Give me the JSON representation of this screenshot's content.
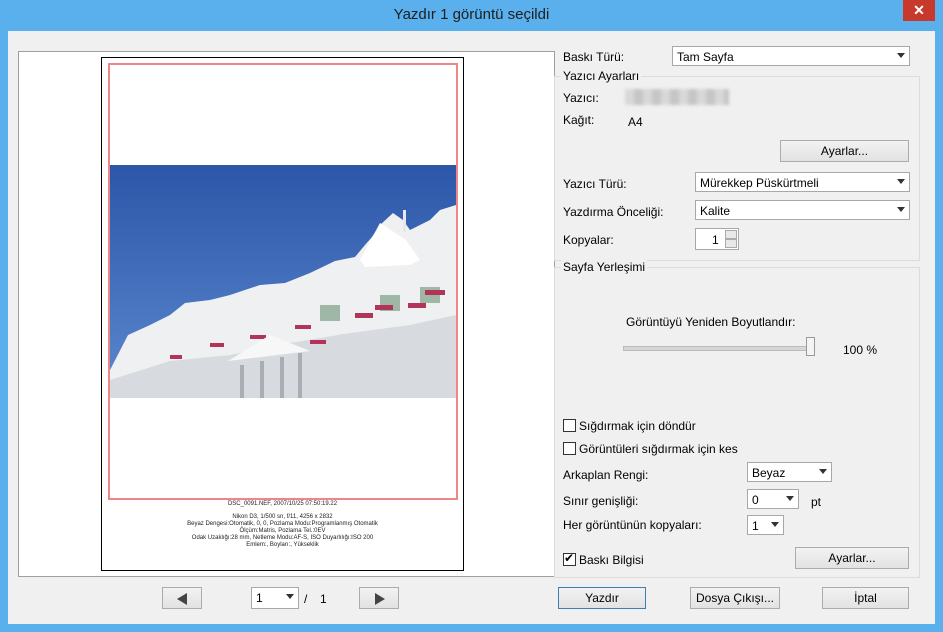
{
  "window": {
    "title": "Yazdır  1 görüntü seçildi",
    "close_glyph": "✕"
  },
  "preview": {
    "info_lines": [
      "DSC_0091.NEF, 2007/10/25 07:50:19.22",
      "Nikon D3, 1/500 sn, f/11, 4256 x 2832",
      "Beyaz Dengesi:Otomatik, 0, 0, Pozlama Modu:Programlanmış Otomatik",
      "Ölçüm:Matris, Pozlama Tel.:0EV",
      "Odak Uzaklığı:28 mm, Netleme Modu:AF-S, ISO Duyarlılığı:ISO 200",
      "Emlem:, Boyları:, Yükseklik"
    ],
    "prev_icon": "arrow-left-icon",
    "next_icon": "arrow-right-icon",
    "page_value": "1",
    "page_sep": "/",
    "page_total": "1"
  },
  "settings": {
    "print_type_label": "Baskı Türü:",
    "print_type_value": "Tam Sayfa",
    "printer_group_title": "Yazıcı Ayarları",
    "printer_label": "Yazıcı:",
    "paper_label": "Kağıt:",
    "paper_value": "A4",
    "settings_button": "Ayarlar...",
    "printer_type_label": "Yazıcı Türü:",
    "printer_type_value": "Mürekkep Püskürtmeli",
    "priority_label": "Yazdırma Önceliği:",
    "priority_value": "Kalite",
    "copies_label": "Kopyalar:",
    "copies_value": "1"
  },
  "layout": {
    "group_title": "Sayfa Yerleşimi",
    "resize_label": "Görüntüyü Yeniden Boyutlandır:",
    "resize_value": 100,
    "resize_text": "100 %",
    "rotate_label": "Sığdırmak için döndür",
    "rotate_checked": false,
    "crop_label": "Görüntüleri sığdırmak için kes",
    "crop_checked": false,
    "bg_label": "Arkaplan Rengi:",
    "bg_value": "Beyaz",
    "border_label": "Sınır genişliği:",
    "border_value": "0",
    "border_unit": "pt",
    "per_image_label": "Her görüntünün kopyaları:",
    "per_image_value": "1",
    "print_info_label": "Baskı Bilgisi",
    "print_info_checked": true,
    "print_info_button": "Ayarlar..."
  },
  "footer": {
    "print_button": "Yazdır",
    "file_output_button": "Dosya Çıkışı...",
    "cancel_button": "İptal"
  },
  "colors": {
    "titlebar": "#5ab0ec",
    "close": "#c7392b",
    "print_area_border": "#ee8686",
    "sky": "#3a66b4"
  }
}
